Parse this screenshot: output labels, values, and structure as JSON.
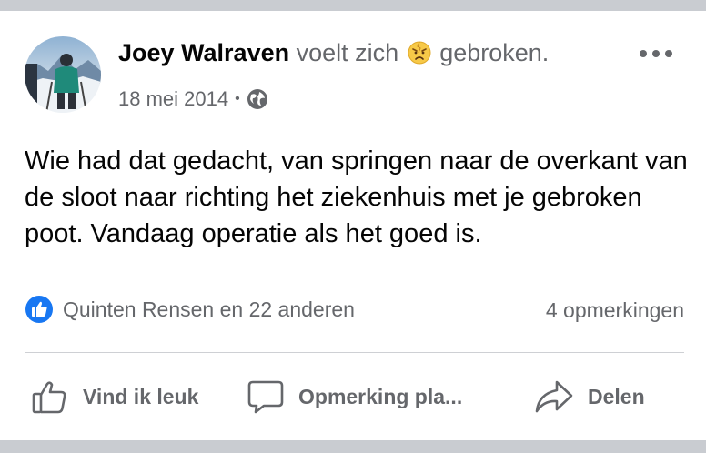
{
  "post": {
    "author": "Joey Walraven",
    "feeling_prefix": "voelt zich",
    "feeling_icon": "broken-face-emoji",
    "feeling": "gebroken.",
    "date": "18 mei 2014",
    "separator": "•",
    "audience_icon": "globe-icon",
    "text": "Wie had dat gedacht, van springen naar de overkant van de sloot naar richting het ziekenhuis met je gebroken poot. Vandaag operatie als het goed is."
  },
  "reactions": {
    "icon": "like-reaction-icon",
    "summary": "Quinten Rensen en 22 anderen",
    "comments": "4 opmerkingen"
  },
  "actions": {
    "like": "Vind ik leuk",
    "comment": "Opmerking pla...",
    "share": "Delen"
  },
  "colors": {
    "primary_text": "#050505",
    "secondary_text": "#65676b",
    "like_blue": "#1877f2",
    "divider": "#ced0d4",
    "page_bg": "#c9ccd1"
  }
}
